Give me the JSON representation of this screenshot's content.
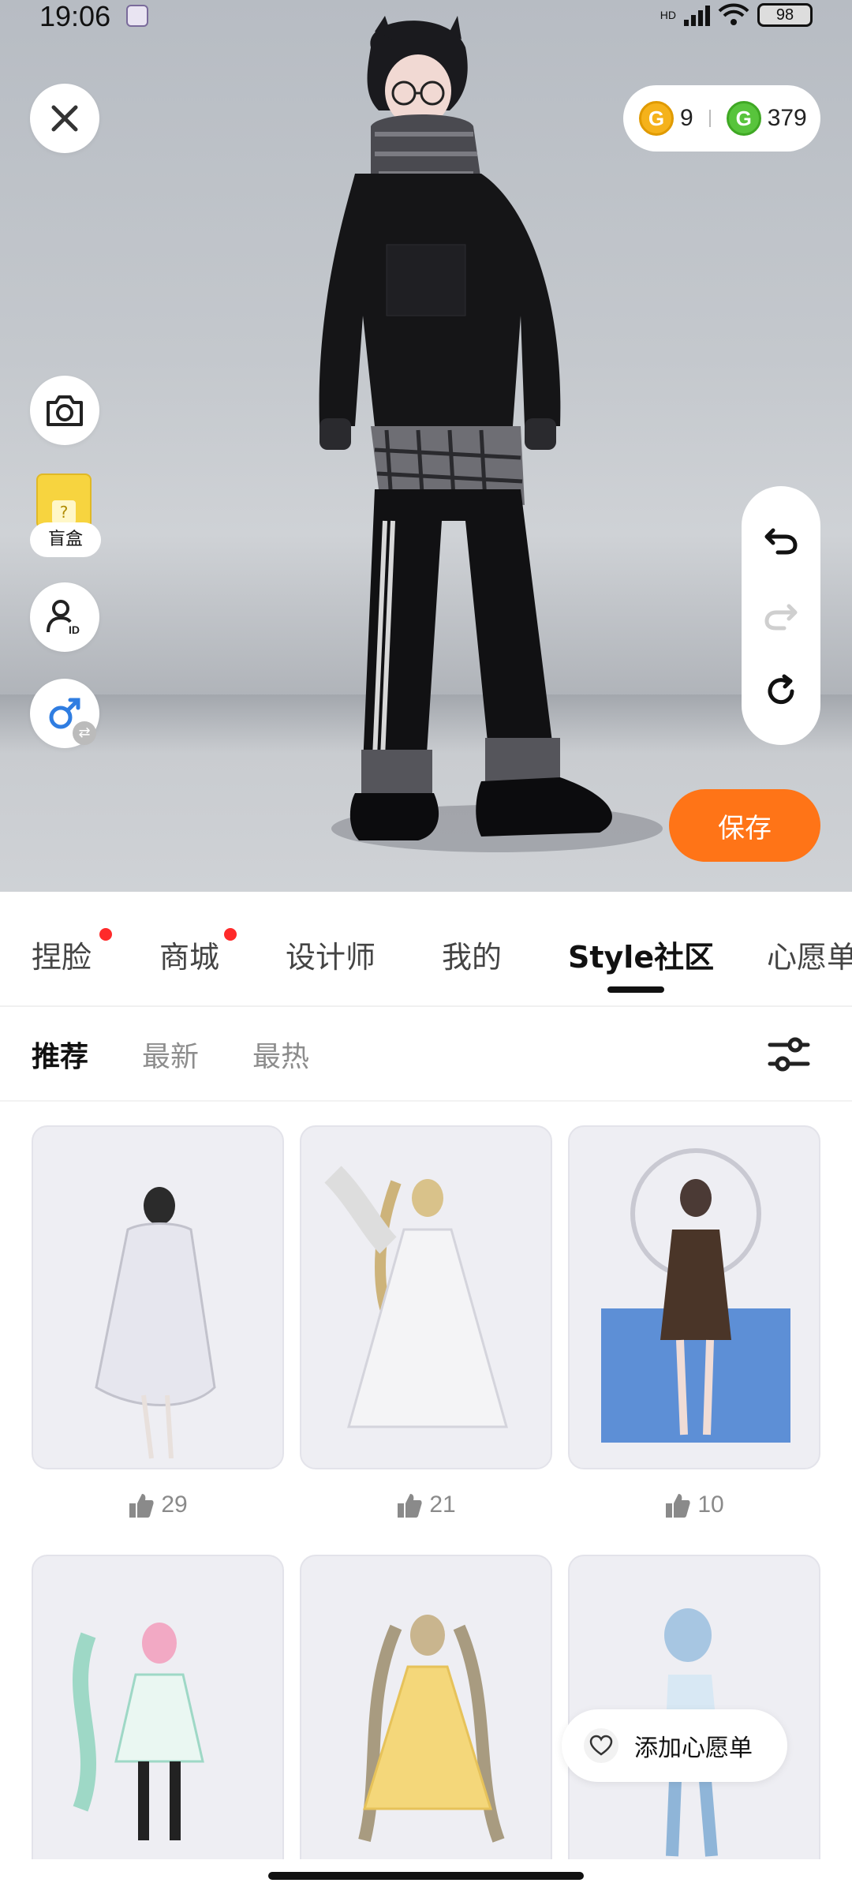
{
  "status_bar": {
    "time": "19:06",
    "battery": "98",
    "network": "HD"
  },
  "stage": {
    "currency": [
      {
        "icon": "gold-coin-icon",
        "value": "9"
      },
      {
        "icon": "green-coin-icon",
        "value": "379"
      }
    ],
    "blindbox_label": "盲盒",
    "save_label": "保存"
  },
  "main_tabs": [
    {
      "label": "捏脸",
      "has_dot": true
    },
    {
      "label": "商城",
      "has_dot": true
    },
    {
      "label": "设计师",
      "has_dot": false
    },
    {
      "label": "我的",
      "has_dot": false
    },
    {
      "label": "Style社区",
      "active": true
    },
    {
      "label": "心愿单",
      "has_dot": false
    }
  ],
  "sub_tabs": [
    {
      "label": "推荐",
      "active": true
    },
    {
      "label": "最新"
    },
    {
      "label": "最热"
    }
  ],
  "outfits": [
    {
      "likes": "29"
    },
    {
      "likes": "21"
    },
    {
      "likes": "10"
    },
    {
      "likes": ""
    },
    {
      "likes": ""
    },
    {
      "likes": ""
    }
  ],
  "wishlist_label": "添加心愿单",
  "colors": {
    "accent": "#ff7417",
    "dot": "#ff2a2a",
    "gold": "#f5b21b",
    "green": "#58c43c"
  }
}
